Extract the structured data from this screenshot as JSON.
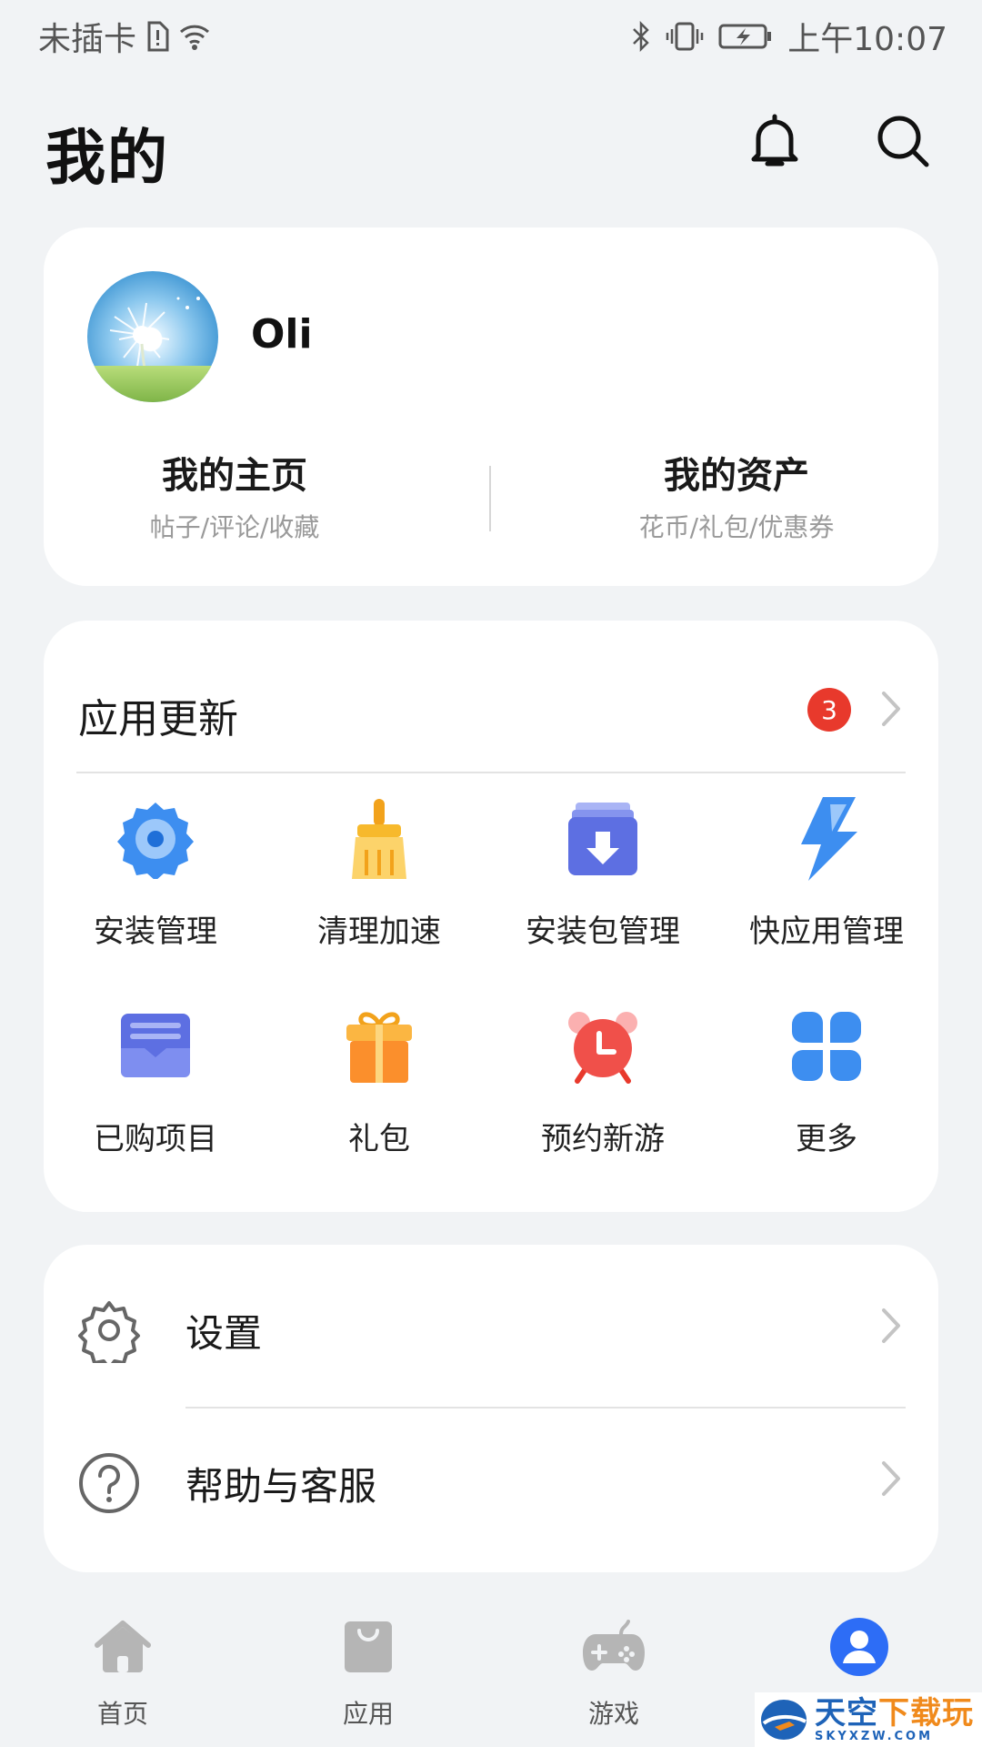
{
  "status_bar": {
    "sim_text": "未插卡",
    "time": "上午10:07",
    "icons": [
      "sim-alert-icon",
      "wifi-icon",
      "bluetooth-icon",
      "vibrate-icon",
      "battery-charging-icon"
    ]
  },
  "header": {
    "title": "我的",
    "icons": [
      "bell-icon",
      "search-icon"
    ]
  },
  "profile": {
    "username": "Oli",
    "homepage_title": "我的主页",
    "homepage_sub": "帖子/评论/收藏",
    "assets_title": "我的资产",
    "assets_sub": "花币/礼包/优惠券"
  },
  "app_updates": {
    "title": "应用更新",
    "badge_count": "3"
  },
  "grid": [
    {
      "label": "安装管理",
      "icon": "install-gear-icon"
    },
    {
      "label": "清理加速",
      "icon": "broom-icon"
    },
    {
      "label": "安装包管理",
      "icon": "package-download-icon"
    },
    {
      "label": "快应用管理",
      "icon": "lightning-icon"
    },
    {
      "label": "已购项目",
      "icon": "purchased-wallet-icon"
    },
    {
      "label": "礼包",
      "icon": "gift-icon"
    },
    {
      "label": "预约新游",
      "icon": "alarm-clock-icon"
    },
    {
      "label": "更多",
      "icon": "more-grid-icon"
    }
  ],
  "settings_rows": [
    {
      "label": "设置",
      "icon": "settings-gear-icon"
    },
    {
      "label": "帮助与客服",
      "icon": "help-icon"
    }
  ],
  "bottom_nav": [
    {
      "label": "首页",
      "icon": "home-icon"
    },
    {
      "label": "应用",
      "icon": "apps-bag-icon"
    },
    {
      "label": "游戏",
      "icon": "gamepad-icon"
    },
    {
      "label": "",
      "icon": "profile-icon",
      "active": true
    }
  ],
  "watermark": {
    "main": "天空",
    "accent": "下载玩",
    "sub": "SKYXZW.COM"
  },
  "colors": {
    "background": "#f1f3f5",
    "badge": "#e8392c",
    "active_nav": "#2d6df6",
    "inactive_nav": "#b5b5b5"
  }
}
